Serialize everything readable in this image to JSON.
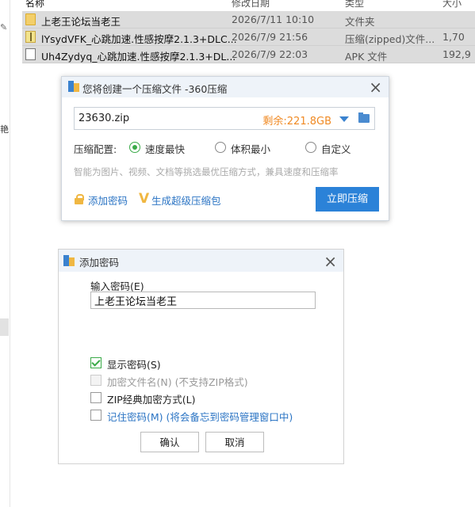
{
  "file_list": {
    "headers": {
      "name": "名称",
      "date": "修改日期",
      "type": "类型",
      "size": "大小"
    },
    "rows": [
      {
        "icon": "folder-icon",
        "name": "上老王论坛当老王",
        "date": "2026/7/11 10:10",
        "type": "文件夹",
        "size": ""
      },
      {
        "icon": "zip-icon",
        "name": "lYsydVFK_心跳加速.性感按摩2.1.3+DLC...",
        "date": "2026/7/9 21:56",
        "type": "压缩(zipped)文件...",
        "size": "1,70"
      },
      {
        "icon": "file-icon",
        "name": "Uh4Zydyq_心跳加速.性感按摩2.1.3+DL...",
        "date": "2026/7/9 22:03",
        "type": "APK 文件",
        "size": "192,9"
      }
    ]
  },
  "sidebar": {
    "char": "艳"
  },
  "compress_dialog": {
    "title": "您将创建一个压缩文件 -360压缩",
    "filename": "23630.zip",
    "free_space": "剩余:221.8GB",
    "config_label": "压缩配置:",
    "options": [
      {
        "label": "速度最快",
        "selected": true
      },
      {
        "label": "体积最小",
        "selected": false
      },
      {
        "label": "自定义",
        "selected": false
      }
    ],
    "hint": "智能为图片、视频、文档等挑选最优压缩方式，兼具速度和压缩率",
    "add_password": "添加密码",
    "super_pack": "生成超级压缩包",
    "compress_button": "立即压缩"
  },
  "password_dialog": {
    "title": "添加密码",
    "input_label": "输入密码(E)",
    "password_value": "上老王论坛当老王",
    "checkboxes": [
      {
        "label": "显示密码(S)",
        "checked": true,
        "disabled": false
      },
      {
        "label": "加密文件名(N) (不支持ZIP格式)",
        "checked": false,
        "disabled": true
      },
      {
        "label": "ZIP经典加密方式(L)",
        "checked": false,
        "disabled": false
      },
      {
        "label": "记住密码(M) (将会备忘到密码管理窗口中)",
        "checked": false,
        "disabled": false
      }
    ],
    "ok_button": "确认",
    "cancel_button": "取消"
  },
  "colors": {
    "accent": "#2b82d8",
    "green": "#3aaa48",
    "orange": "#f08a24"
  }
}
